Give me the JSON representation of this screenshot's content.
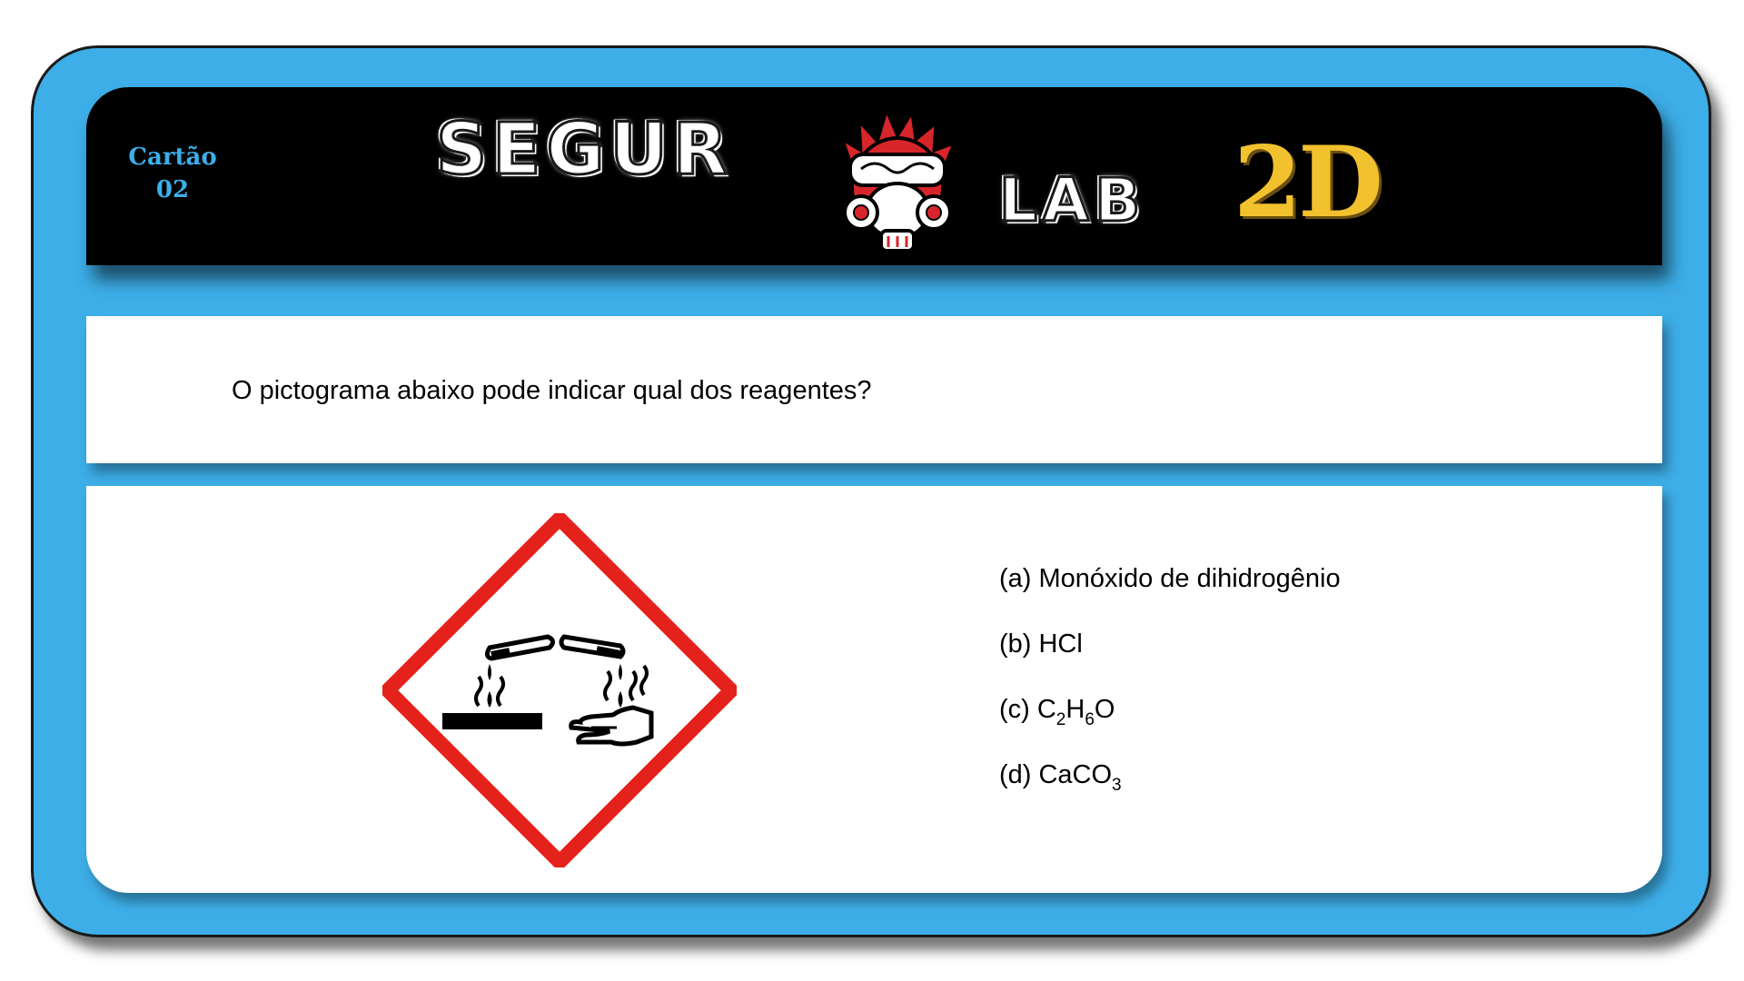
{
  "header": {
    "card_label": "Cartão",
    "card_number": "02",
    "logo": {
      "word1": "SEGUR",
      "word2": "LAB",
      "suffix": "2D",
      "mascot_icon": "gas-mask-icon"
    }
  },
  "question": {
    "text": "O pictograma abaixo pode indicar qual dos reagentes?",
    "pictogram_icon": "ghs-corrosive-icon"
  },
  "options": [
    {
      "letter": "(a)",
      "parts": [
        {
          "t": "Monóxido de dihidrogênio"
        }
      ]
    },
    {
      "letter": "(b)",
      "parts": [
        {
          "t": "HCl"
        }
      ]
    },
    {
      "letter": "(c)",
      "parts": [
        {
          "t": "C"
        },
        {
          "sub": "2"
        },
        {
          "t": "H"
        },
        {
          "sub": "6"
        },
        {
          "t": "O"
        }
      ]
    },
    {
      "letter": "(d)",
      "parts": [
        {
          "t": "CaCO"
        },
        {
          "sub": "3"
        }
      ]
    }
  ],
  "colors": {
    "frame": "#3daee8",
    "header_bg": "#000000",
    "accent_gold": "#f2c12e",
    "pictogram_red": "#e5211c",
    "mascot_red": "#d7262b"
  }
}
